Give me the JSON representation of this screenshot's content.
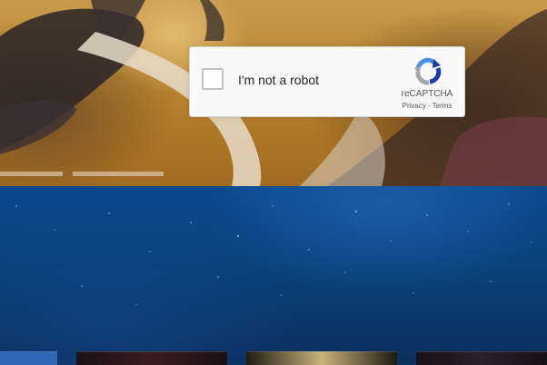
{
  "recaptcha": {
    "checkbox_label": "I'm not a robot",
    "brand": "reCAPTCHA",
    "privacy_link": "Privacy",
    "separator": "-",
    "terms_link": "Terms",
    "logo_icon": "recaptcha-logo-icon",
    "accent_color": "#1c3aa9",
    "logo_gray": "#a6a6a6"
  },
  "page": {
    "hero_accent": "#b47f2c",
    "band_color": "#0b3f78"
  }
}
